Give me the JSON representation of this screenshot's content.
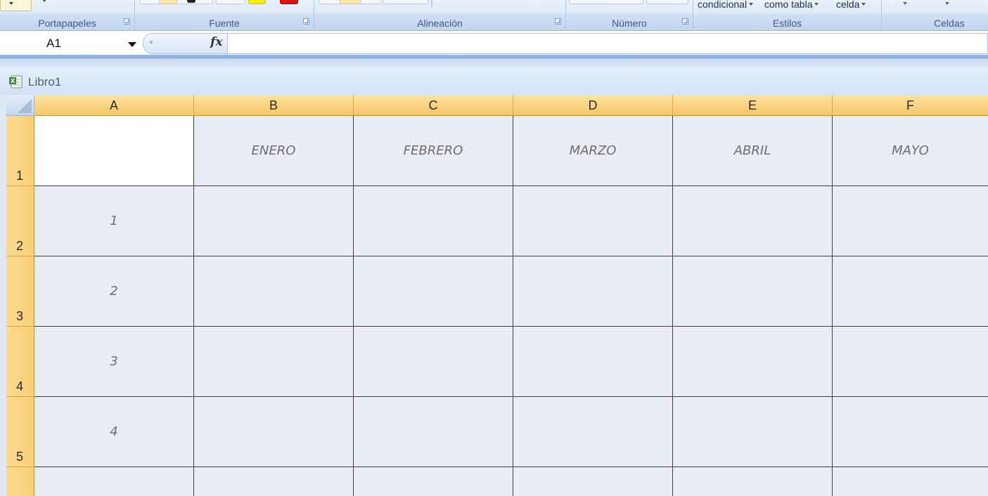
{
  "ribbon": {
    "groups": [
      {
        "label": "Portapapeles"
      },
      {
        "label": "Fuente"
      },
      {
        "label": "Alineación"
      },
      {
        "label": "Número"
      },
      {
        "label": "Estilos"
      },
      {
        "label": "Celdas"
      }
    ],
    "styles_buttons": [
      "condicional",
      "como tabla",
      "celda"
    ]
  },
  "formula_bar": {
    "name_box": "A1",
    "fx_label": "fx",
    "formula": ""
  },
  "workbook": {
    "title": "Libro1"
  },
  "sheet": {
    "columns": [
      "A",
      "B",
      "C",
      "D",
      "E",
      "F"
    ],
    "rows": [
      "1",
      "2",
      "3",
      "4",
      "5",
      ""
    ],
    "cells": [
      [
        "",
        "ENERO",
        "FEBRERO",
        "MARZO",
        "ABRIL",
        "MAYO"
      ],
      [
        "1",
        "",
        "",
        "",
        "",
        ""
      ],
      [
        "2",
        "",
        "",
        "",
        "",
        ""
      ],
      [
        "3",
        "",
        "",
        "",
        "",
        ""
      ],
      [
        "4",
        "",
        "",
        "",
        "",
        ""
      ],
      [
        "",
        "",
        "",
        "",
        "",
        ""
      ]
    ],
    "active_cell": "A1"
  },
  "colors": {
    "header_highlight": "#f7c768",
    "cell_fill": "#e9ebf5",
    "ribbon_blue": "#c9dbf2"
  }
}
